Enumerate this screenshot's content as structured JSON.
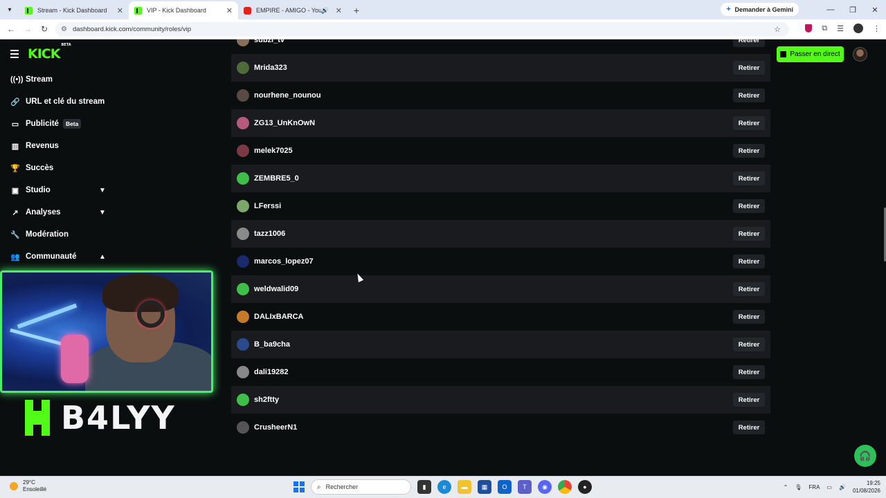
{
  "browser": {
    "tabs": [
      {
        "title": "Stream - Kick Dashboard",
        "favicon": "kick-icon",
        "active": false
      },
      {
        "title": "VIP - Kick Dashboard",
        "favicon": "kick-icon",
        "active": true
      },
      {
        "title": "EMPIRE - AMIGO - YouTube",
        "favicon": "youtube-icon",
        "active": false
      }
    ],
    "gemini_label": "Demander à Gemini",
    "url": "dashboard.kick.com/community/roles/vip"
  },
  "header": {
    "logo": "KICK",
    "logo_badge": "BETA",
    "go_live_label": "Passer en direct",
    "accent": "#53fc18"
  },
  "sidebar": {
    "items": [
      {
        "label": "Stream",
        "icon": "broadcast-icon"
      },
      {
        "label": "URL et clé du stream",
        "icon": "link-icon"
      },
      {
        "label": "Publicité",
        "icon": "ad-icon",
        "badge": "Beta"
      },
      {
        "label": "Revenus",
        "icon": "chart-icon"
      },
      {
        "label": "Succès",
        "icon": "trophy-icon"
      },
      {
        "label": "Studio",
        "icon": "studio-icon",
        "chevron": "down"
      },
      {
        "label": "Analyses",
        "icon": "analytics-icon",
        "chevron": "down"
      },
      {
        "label": "Modération",
        "icon": "wrench-icon"
      },
      {
        "label": "Communauté",
        "icon": "community-icon",
        "chevron": "up"
      }
    ]
  },
  "overlay": {
    "brand_name": "B4LYY"
  },
  "vip_list": {
    "remove_label": "Retirer",
    "users": [
      {
        "name": "subzi_tv",
        "avatar_color": "#8a6e5a"
      },
      {
        "name": "Mrida323",
        "avatar_color": "#4f6b3a"
      },
      {
        "name": "nourhene_nounou",
        "avatar_color": "#5a4a44"
      },
      {
        "name": "ZG13_UnKnOwN",
        "avatar_color": "#b55a7a"
      },
      {
        "name": "melek7025",
        "avatar_color": "#7a3a44"
      },
      {
        "name": "ZEMBRE5_0",
        "avatar_color": "#3fbf4a"
      },
      {
        "name": "LFerssi",
        "avatar_color": "#7ba86a"
      },
      {
        "name": "tazz1006",
        "avatar_color": "#8a8a8a"
      },
      {
        "name": "marcos_lopez07",
        "avatar_color": "#1a2a6a"
      },
      {
        "name": "weldwalid09",
        "avatar_color": "#3fbf4a"
      },
      {
        "name": "DALIxBARCA",
        "avatar_color": "#c47a2a"
      },
      {
        "name": "B_ba9cha",
        "avatar_color": "#2a4a8a"
      },
      {
        "name": "dali19282",
        "avatar_color": "#888888"
      },
      {
        "name": "sh2ftty",
        "avatar_color": "#3fbf4a"
      },
      {
        "name": "CrusheerN1",
        "avatar_color": "#555555"
      }
    ]
  },
  "taskbar": {
    "temperature": "29°C",
    "weather": "Ensoleillé",
    "search_placeholder": "Rechercher",
    "language": "FRA",
    "time": "19:25",
    "date": "01/08/2026"
  }
}
